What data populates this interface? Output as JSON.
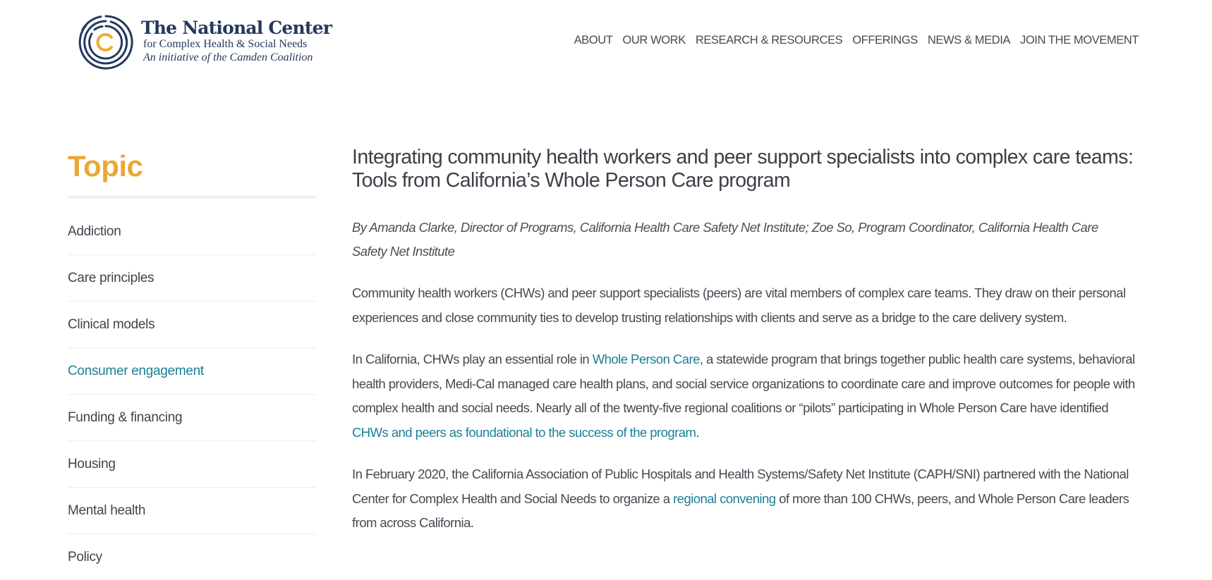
{
  "header": {
    "logo": {
      "title": "The National Center",
      "subtitle": "for Complex Health & Social Needs",
      "initiative": "An initiative of the Camden Coalition",
      "icon": "concentric-circles-logo-icon",
      "colors": {
        "navy": "#23395d",
        "gold": "#f0ac2a"
      }
    },
    "nav": [
      {
        "label": "ABOUT"
      },
      {
        "label": "OUR WORK"
      },
      {
        "label": "RESEARCH & RESOURCES"
      },
      {
        "label": "OFFERINGS"
      },
      {
        "label": "NEWS & MEDIA"
      },
      {
        "label": "JOIN THE MOVEMENT"
      }
    ]
  },
  "sidebar": {
    "title": "Topic",
    "items": [
      {
        "label": "Addiction",
        "active": false
      },
      {
        "label": "Care principles",
        "active": false
      },
      {
        "label": "Clinical models",
        "active": false
      },
      {
        "label": "Consumer engagement",
        "active": true
      },
      {
        "label": "Funding & financing",
        "active": false
      },
      {
        "label": "Housing",
        "active": false
      },
      {
        "label": "Mental health",
        "active": false
      },
      {
        "label": "Policy",
        "active": false
      }
    ]
  },
  "article": {
    "title": "Integrating community health workers and peer support specialists into complex care teams: Tools from California’s Whole Person Care program",
    "byline": "By Amanda Clarke, Director of Programs, California Health Care Safety Net Institute; Zoe So, Program Coordinator, California Health Care Safety Net Institute",
    "paragraphs": [
      {
        "text": "Community health workers (CHWs) and peer support specialists (peers) are vital members of complex care teams. They draw on their personal experiences and close community ties to develop trusting relationships with clients and serve as a bridge to the care delivery system."
      },
      {
        "before_link1": "In California, CHWs play an essential role in ",
        "link1": "Whole Person Care",
        "between": ", a statewide program that brings together public health care systems, behavioral health providers, Medi-Cal managed care health plans, and social service organizations to coordinate care and improve outcomes for people with complex health and social needs. Nearly all of the twenty-five regional coalitions or “pilots” participating in Whole Person Care have identified ",
        "link2": "CHWs and peers as foundational to the success of the program",
        "after": "."
      },
      {
        "before_link": "In February 2020, the California Association of Public Hospitals and Health Systems/Safety Net Institute (CAPH/SNI) partnered with the National Center for Complex Health and Social Needs to organize a ",
        "link": "regional convening",
        "after": " of more than 100 CHWs, peers, and Whole Person Care leaders from across California."
      }
    ]
  },
  "colors": {
    "accent_gold": "#e9a837",
    "link_teal": "#1b7f98",
    "body_text": "#454a52"
  }
}
